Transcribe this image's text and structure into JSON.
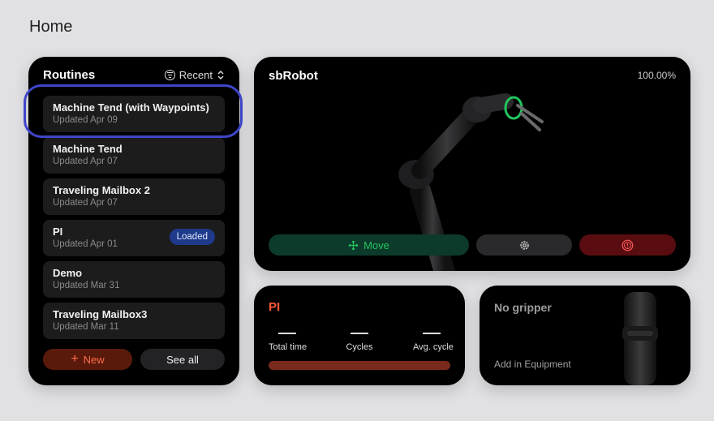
{
  "page": {
    "title": "Home"
  },
  "routines": {
    "title": "Routines",
    "sort_label": "Recent",
    "items": [
      {
        "name": "Machine Tend (with Waypoints)",
        "updated": "Updated Apr 09",
        "badge": ""
      },
      {
        "name": "Machine Tend",
        "updated": "Updated Apr 07",
        "badge": ""
      },
      {
        "name": "Traveling Mailbox 2",
        "updated": "Updated Apr 07",
        "badge": ""
      },
      {
        "name": "PI",
        "updated": "Updated Apr 01",
        "badge": "Loaded"
      },
      {
        "name": "Demo",
        "updated": "Updated Mar 31",
        "badge": ""
      },
      {
        "name": "Traveling Mailbox3",
        "updated": "Updated Mar 11",
        "badge": ""
      }
    ],
    "new_label": "New",
    "see_all_label": "See all"
  },
  "robot": {
    "name": "sbRobot",
    "speed": "100.00%",
    "move_label": "Move",
    "settings_icon": "gear-icon",
    "stop_icon": "emergency-stop-icon"
  },
  "stats": {
    "routine_name": "PI",
    "total_time_label": "Total time",
    "cycles_label": "Cycles",
    "avg_cycle_label": "Avg. cycle",
    "progress_fraction": 1.0
  },
  "gripper": {
    "title": "No gripper",
    "subtitle": "Add in Equipment"
  },
  "colors": {
    "accent_orange": "#ff5a3a",
    "move_green": "#22c55e",
    "loaded_badge": "#1e3a8a",
    "selection_outline": "#3f46c9"
  }
}
